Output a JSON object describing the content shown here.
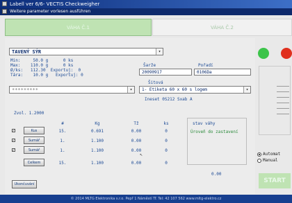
{
  "window": {
    "title": "Labell ver 6/6- VECTIS Checkweigher",
    "menu": "Weitere parameter vorlesen ausführen"
  },
  "tabs": [
    {
      "label": "VÁHA Č.1"
    },
    {
      "label": "VÁHA Č.2"
    }
  ],
  "product": {
    "selected": "TAVENÝ SÝR",
    "info": [
      "Min:     50.0 g      0 ks",
      "Max:    110.0 g      0 ks",
      "Ø/ks:   112.30  Exportuj:  0",
      "Tára:    10.0 g   Exportuj: 0"
    ]
  },
  "dropdown2": {
    "value": "*********"
  },
  "fields": {
    "lot": {
      "label": "Šarže",
      "value": "20090917"
    },
    "date": {
      "label": "Pořadí",
      "value": "0106Da"
    },
    "label_template": {
      "label": "Šitová",
      "value": "1- Etiketa 60 x 60 s logem"
    },
    "barcode_info": "Ineset 0S212  Sxab  A"
  },
  "weigh_info": "Zvol. 1.2000",
  "table": {
    "headers": [
      "#",
      "Kg",
      "Tž",
      "ks"
    ],
    "rows": [
      {
        "button": "Kus",
        "checked": true,
        "count": "15.",
        "kg": "0.691",
        "tz": "0.00",
        "ks": "0"
      },
      {
        "button": "Sumář",
        "checked": true,
        "count": "1.",
        "kg": "1.100",
        "tz": "0.00",
        "ks": "0"
      },
      {
        "button": "Sumář",
        "checked": true,
        "count": "1.",
        "kg": "1.100",
        "tz": "0.00",
        "ks": "0"
      },
      {
        "button": "Celkem",
        "checked": false,
        "count": "15.",
        "kg": "1.100",
        "tz": "0.00",
        "ks": "0"
      }
    ]
  },
  "notes": {
    "title": "stav váhy",
    "text": "Úroveň do zastavení"
  },
  "small_value": "0.00",
  "bottom_button": "Ukončuvání",
  "mode": {
    "options": [
      "Automat",
      "Manual"
    ],
    "selected": "Automat"
  },
  "start_label": "START",
  "status_bar": "© 2014 MLTG Elektronika s.r.o.  Pepř 1 Náměstí Tř.  Tel: 42 107 562 www.mltg-elektro.cz",
  "indicators": {
    "green": "#3cc44a",
    "red": "#e0301e"
  }
}
